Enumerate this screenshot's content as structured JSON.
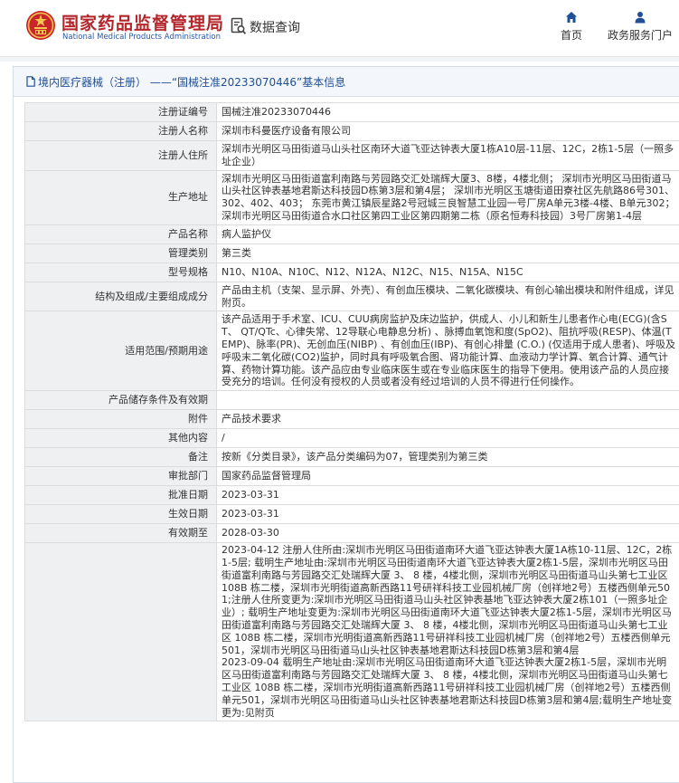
{
  "header": {
    "logo_cn": "国家药品监督管理局",
    "logo_en": "National Medical Products Administration",
    "query_label": "数据查询",
    "nav": [
      {
        "label": "首页",
        "icon": "home-icon"
      },
      {
        "label": "政务服务门户",
        "icon": "user-icon"
      }
    ],
    "colors": {
      "brand_red": "#b3262b",
      "brand_blue": "#2a57a8",
      "link_blue": "#1f4f96"
    }
  },
  "breadcrumb": {
    "text": "境内医疗器械（注册） ——“国械注准20233070446”基本信息"
  },
  "record": {
    "rows": [
      {
        "label": "注册证编号",
        "value": "国械注准20233070446"
      },
      {
        "label": "注册人名称",
        "value": "深圳市科曼医疗设备有限公司"
      },
      {
        "label": "注册人住所",
        "value": "深圳市光明区马田街道马山头社区南环大道飞亚达钟表大厦1栋A10层-11层、12C，2栋1-5层（一照多址企业）"
      },
      {
        "label": "生产地址",
        "value": "深圳市光明区马田街道富利南路与芳园路交汇处瑞辉大厦3、8楼，4楼北侧； 深圳市光明区马田街道马山头社区钟表基地君斯达科技园D栋第3层和第4层； 深圳市光明区玉塘街道田寮社区先航路86号301、302、402、403； 东莞市黄江镇辰星路2号冠城三良智慧工业园一号厂房A单元3楼-4楼、B单元302； 深圳市光明区马田街道合水口社区第四工业区第四期第二栋（原名恒寿科技园）3号厂房第1-4层"
      },
      {
        "label": "产品名称",
        "value": "病人监护仪"
      },
      {
        "label": "管理类别",
        "value": "第三类"
      },
      {
        "label": "型号规格",
        "value": "N10、N10A、N10C、N12、N12A、N12C、N15、N15A、N15C"
      },
      {
        "label": "结构及组成/主要组成成分",
        "value": "产品由主机（支架、显示屏、外壳）、有创血压模块、二氧化碳模块、有创心输出模块和附件组成，详见附页。"
      },
      {
        "label": "适用范围/预期用途",
        "value": "该产品适用于手术室、ICU、CUU病房监护及床边监护，供成人、小儿和新生儿患者作心电(ECG)(含ST、 QT/QTc、心律失常、12导联心电静息分析) 、脉搏血氧饱和度(SpO2)、阻抗呼吸(RESP)、体温(TEMP)、脉率(PR)、无创血压(NIBP) 、有创血压(IBP)、有创心排量 (C.O.) (仅适用于成人患者)、呼吸及呼吸末二氧化碳(CO2)监护，同时具有呼吸氧合图、肾功能计算、血液动力学计算、氧合计算、通气计算、药物计算功能。该产品应由专业临床医生或在专业临床医生的指导下使用。使用该产品的人员应接受充分的培训。任何没有授权的人员或者没有经过培训的人员不得进行任何操作。"
      },
      {
        "label": "产品储存条件及有效期",
        "value": ""
      },
      {
        "label": "附件",
        "value": "产品技术要求"
      },
      {
        "label": "其他内容",
        "value": "/"
      },
      {
        "label": "备注",
        "value": "按新《分类目录》，该产品分类编码为07，管理类别为第三类"
      },
      {
        "label": "审批部门",
        "value": "国家药品监督管理局"
      },
      {
        "label": "批准日期",
        "value": "2023-03-31"
      },
      {
        "label": "生效日期",
        "value": "2023-03-31"
      },
      {
        "label": "有效期至",
        "value": "2028-03-30"
      }
    ],
    "changes": [
      "2023-04-12 注册人住所由:深圳市光明区马田街道南环大道飞亚达钟表大厦1A栋10-11层、12C，2栋1-5层; 载明生产地址由:深圳市光明区马田街道南环大道飞亚达钟表大厦2栋1-5层，深圳市光明区马田街道富利南路与芳园路交汇处瑞辉大厦 3、 8 楼，4楼北侧，深圳市光明区马田街道马山头第七工业区 108B 栋二楼，深圳市光明街道高新西路11号研祥科技工业园机械厂房（创祥地2号）五楼西侧单元501;注册人住所变更为:深圳市光明区马田街道马山头社区钟表基地飞亚达钟表大厦2栋101（一照多址企业）; 载明生产地址变更为:深圳市光明区马田街道南环大道飞亚达钟表大厦2栋1-5层，深圳市光明区马田街道富利南路与芳园路交汇处瑞辉大厦 3、 8 楼，4楼北侧，深圳市光明区马田街道马山头第七工业区 108B 栋二楼，深圳市光明街道高新西路11号研祥科技工业园机械厂房（创祥地2号）五楼西侧单元501，深圳市光明区马田街道马山头社区钟表基地君斯达科技园D栋第3层和第4层",
      "2023-09-04 载明生产地址由:深圳市光明区马田街道南环大道飞亚达钟表大厦2栋1-5层，深圳市光明区马田街道富利南路与芳园路交汇处瑞辉大厦 3、 8 楼，4楼北侧，深圳市光明区马田街道马山头第七工业区 108B 栋二楼，深圳市光明街道高新西路11号研祥科技工业园机械厂房（创祥地2号）五楼西侧单元501，深圳市光明区马田街道马山头社区钟表基地君斯达科技园D栋第3层和第4层;载明生产地址变更为:见附页"
    ]
  }
}
